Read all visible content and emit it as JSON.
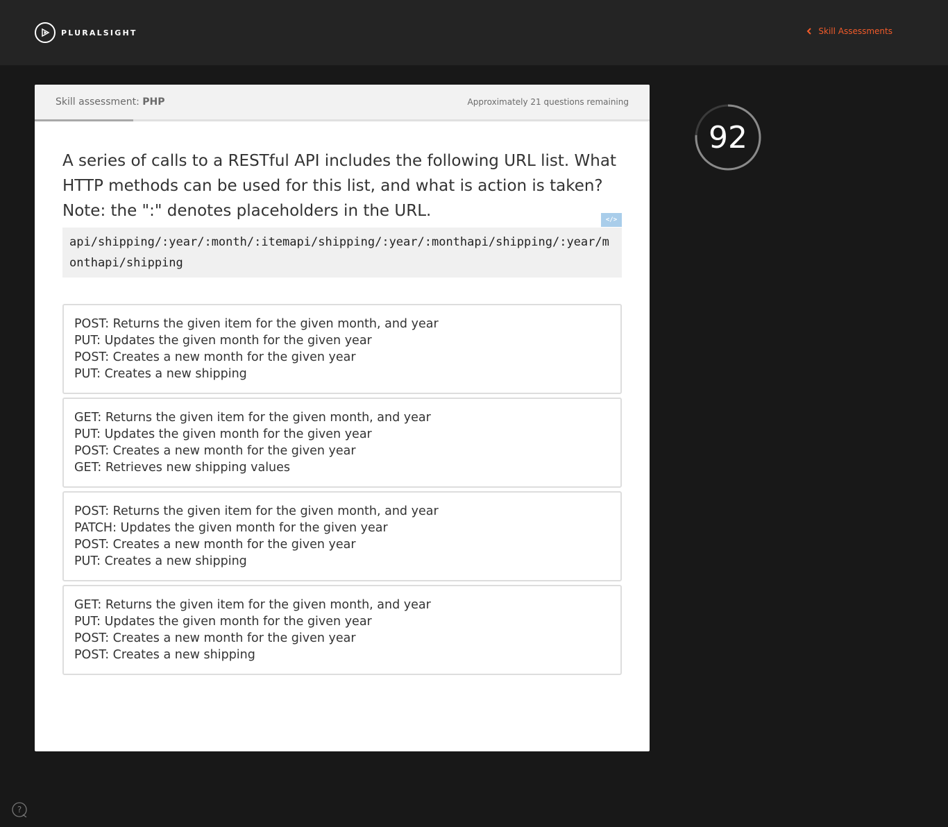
{
  "header": {
    "brand": "PLURALSIGHT",
    "back_link": "Skill Assessments"
  },
  "assessment": {
    "label_prefix": "Skill assessment:",
    "subject": "PHP",
    "remaining": "Approximately 21 questions remaining",
    "progress_fraction": 0.16
  },
  "question": {
    "text": "A series of calls to a RESTful API includes the following URL list. What HTTP methods can be used for this list, and what is action is taken? Note: the \":\" denotes placeholders in the URL.",
    "code_toggle": "</>",
    "code": "api/shipping/:year/:month/:itemapi/shipping/:year/:monthapi/shipping/:year/monthapi/shipping"
  },
  "answers": [
    {
      "lines": [
        "POST: Returns the given item for the given month, and year",
        "PUT: Updates the given month for the given year",
        "POST: Creates a new month for the given year",
        "PUT: Creates a new shipping"
      ]
    },
    {
      "lines": [
        "GET: Returns the given item for the given month, and year",
        "PUT: Updates the given month for the given year",
        "POST: Creates a new month for the given year",
        "GET: Retrieves new shipping values"
      ]
    },
    {
      "lines": [
        "POST: Returns the given item for the given month, and year",
        "PATCH: Updates the given month for the given year",
        "POST: Creates a new month for the given year",
        "PUT: Creates a new shipping"
      ]
    },
    {
      "lines": [
        "GET: Returns the given item for the given month, and year",
        "PUT: Updates the given month for the given year",
        "POST: Creates a new month for the given year",
        "POST: Creates a new shipping"
      ]
    }
  ],
  "timer": {
    "seconds": "92",
    "fraction_remaining": 0.76
  },
  "colors": {
    "accent": "#f15b2a",
    "code_toggle": "#a9cdea"
  }
}
